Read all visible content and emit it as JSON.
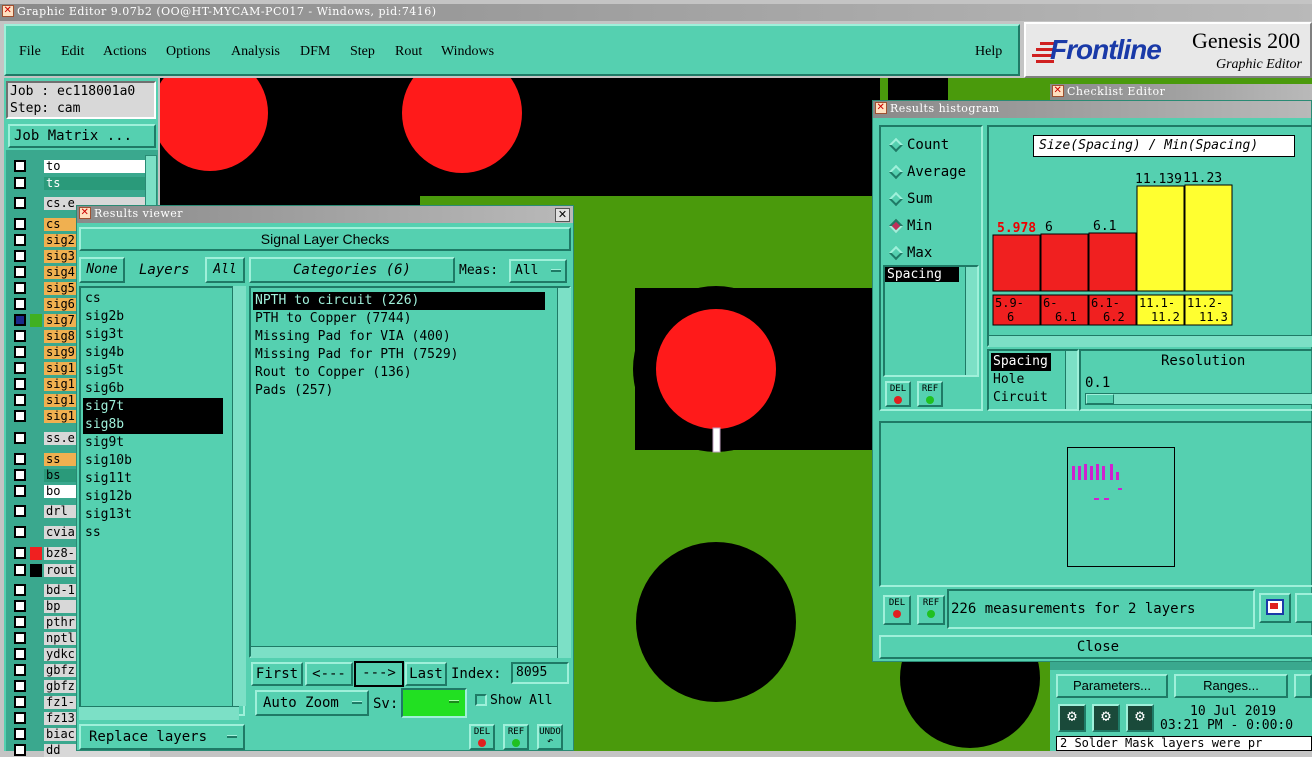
{
  "window_title": "Graphic Editor 9.07b2 (OO@HT-MYCAM-PC017 - Windows, pid:7416)",
  "menu": {
    "file": "File",
    "edit": "Edit",
    "actions": "Actions",
    "options": "Options",
    "analysis": "Analysis",
    "dfm": "DFM",
    "step": "Step",
    "rout": "Rout",
    "windows": "Windows",
    "help": "Help"
  },
  "brand": {
    "logo": "Frontline",
    "product": "Genesis 200",
    "subtitle": "Graphic Editor"
  },
  "job": {
    "job_label": "Job : ec118001a0",
    "step_label": "Step: cam",
    "matrix_button": "Job Matrix ..."
  },
  "layer_panel": {
    "items": [
      "to",
      "ts",
      "cs.e",
      "cs",
      "sig2",
      "sig3",
      "sig4",
      "sig5",
      "sig6",
      "sig7",
      "sig8",
      "sig9",
      "sig1",
      "sig1",
      "sig1",
      "sig1",
      "ss.e",
      "ss",
      "bs",
      "bo",
      "drl",
      "cvia",
      "bz8-",
      "rout",
      "bd-1",
      "bp",
      "pthr",
      "nptl",
      "ydkc",
      "gbfz",
      "gbfz",
      "fz1-",
      "fz13",
      "biac",
      "dd"
    ]
  },
  "results_viewer": {
    "title": "Results viewer",
    "header": "Signal Layer Checks",
    "none_btn": "None",
    "layers_label": "Layers",
    "all_btn": "All",
    "categories_label": "Categories (6)",
    "meas_label": "Meas:",
    "meas_value": "All",
    "layers": [
      "cs",
      "sig2b",
      "sig3t",
      "sig4b",
      "sig5t",
      "sig6b",
      "sig7t",
      "sig8b",
      "sig9t",
      "sig10b",
      "sig11t",
      "sig12b",
      "sig13t",
      "ss"
    ],
    "categories": [
      "NPTH to circuit (226)",
      "PTH to Copper (7744)",
      "Missing Pad for VIA (400)",
      "Missing Pad for PTH (7529)",
      "Rout to Copper (136)",
      "Pads (257)"
    ],
    "first_btn": "First",
    "prev_btn": "<---",
    "next_btn": "--->",
    "last_btn": "Last",
    "index_label": "Index:",
    "index_value": "8095",
    "auto_zoom": "Auto Zoom",
    "sv_label": "Sv:",
    "show_all": "Show All",
    "replace_layers": "Replace layers",
    "del": "DEL",
    "ref": "REF",
    "undo": "UNDO"
  },
  "histogram": {
    "title": "Results histogram",
    "options": [
      "Count",
      "Average",
      "Sum",
      "Min",
      "Max"
    ],
    "selected": "Min",
    "list_item": "Spacing",
    "chart_title": "Size(Spacing) / Min(Spacing)",
    "categories_list": [
      "Spacing",
      "Hole",
      "Circuit"
    ],
    "resolution_label": "Resolution",
    "resolution_value": "0.1",
    "summary": "226 measurements for 2 layers",
    "close_btn": "Close",
    "del": "DEL",
    "ref": "REF"
  },
  "chart_data": {
    "type": "bar",
    "title": "Size(Spacing) / Min(Spacing)",
    "categories": [
      "5.9-6",
      "6-6.1",
      "6.1-6.2",
      "11.1-11.2",
      "11.2-11.3"
    ],
    "values": [
      5.978,
      6,
      6.1,
      11.139,
      11.23
    ],
    "value_labels": [
      "5.978",
      "6",
      "6.1",
      "11.139",
      "11.23"
    ],
    "colors": [
      "#f02020",
      "#f02020",
      "#f02020",
      "#ffff30",
      "#ffff30"
    ],
    "ylim": [
      0,
      12.5
    ]
  },
  "checklist": {
    "title": "Checklist Editor",
    "parameters_btn": "Parameters...",
    "ranges_btn": "Ranges...",
    "date": "10 Jul 2019",
    "time": "03:21 PM - 0:00:0",
    "message": "2 Solder Mask layers were pr"
  },
  "colors": {
    "board": "#4a9a0c",
    "pad_red": "#ff1a1a",
    "panel": "#55d0b0"
  }
}
